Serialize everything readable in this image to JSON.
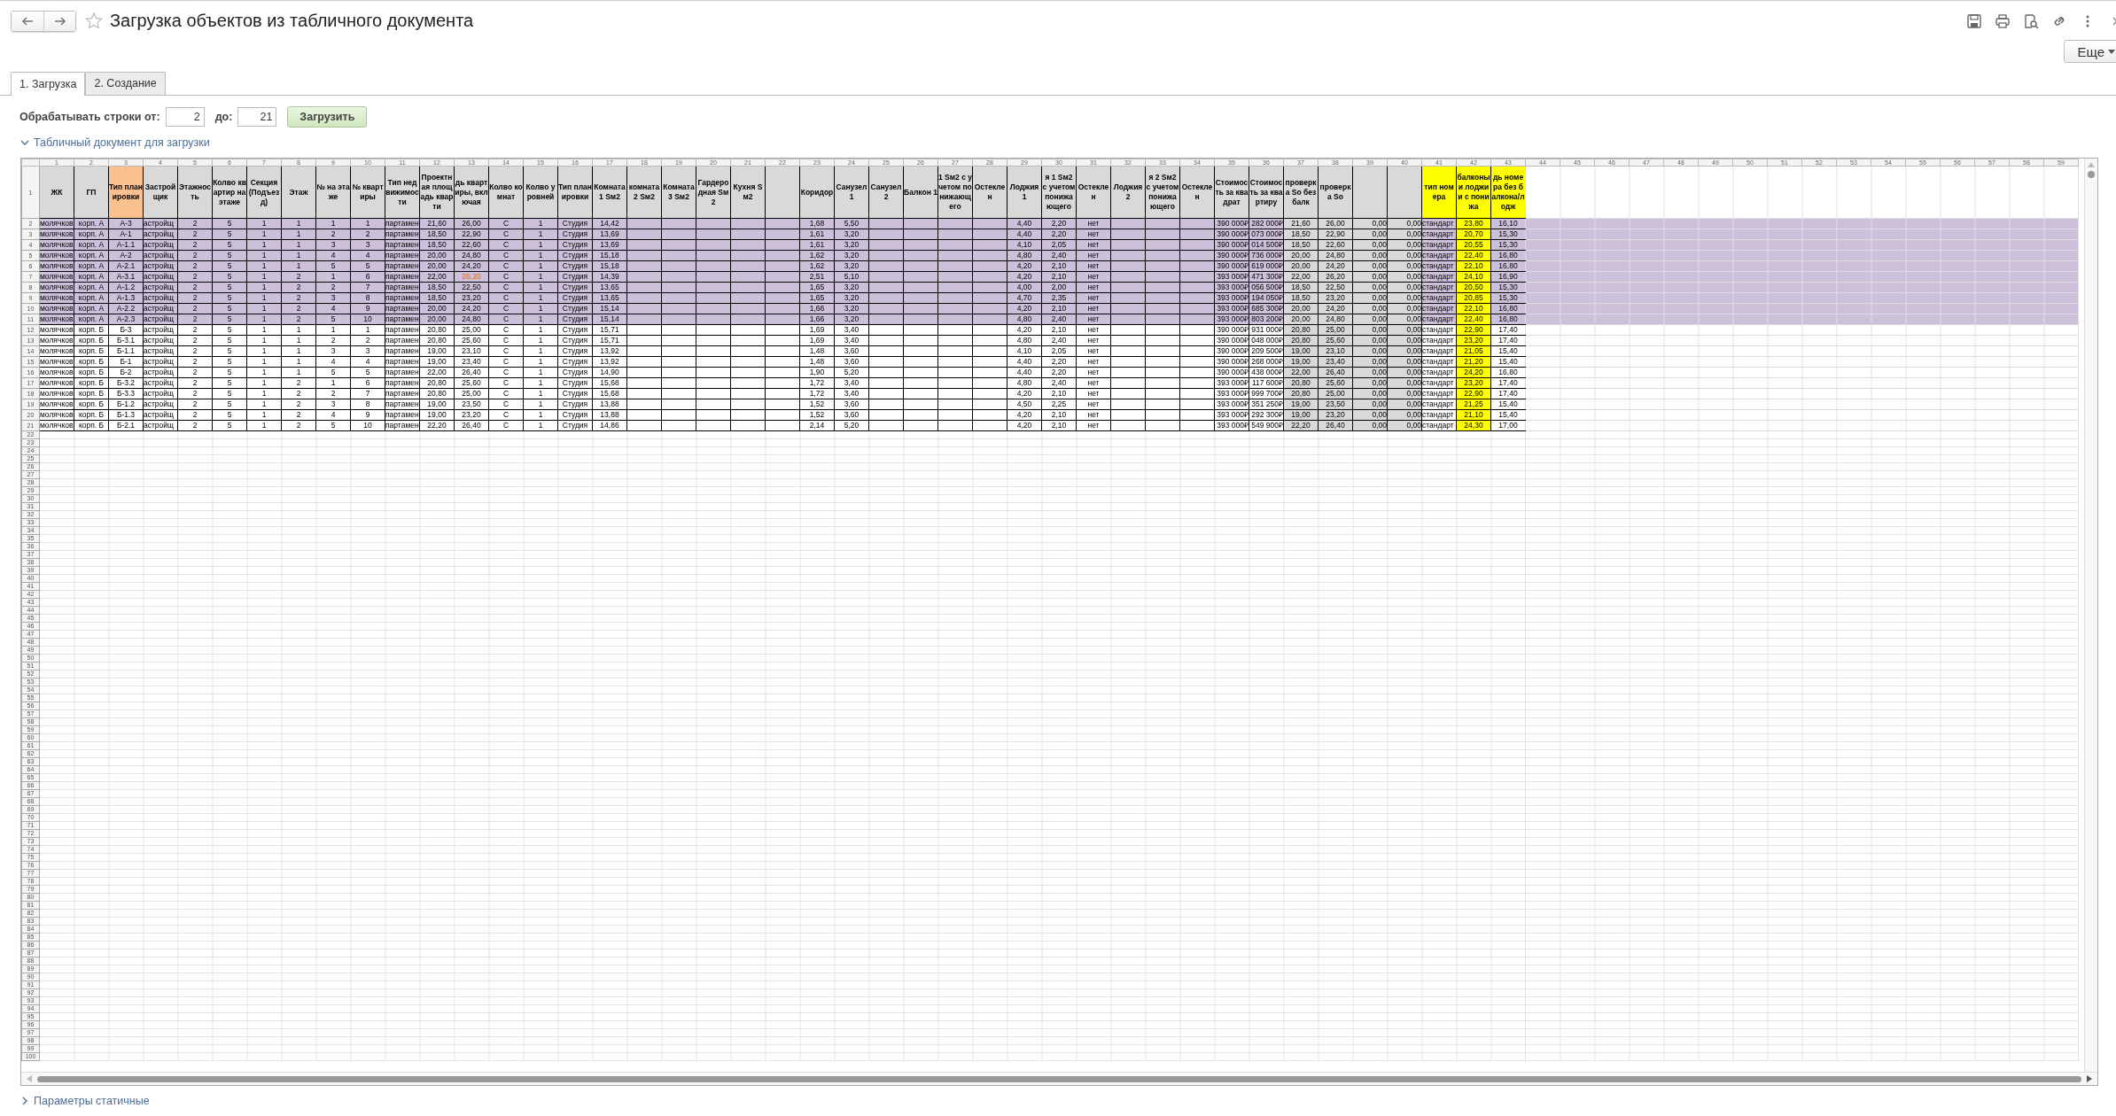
{
  "window": {
    "title": "Загрузка объектов из табличного документа",
    "favorite": false
  },
  "toolbar": {
    "more_button": "Еще"
  },
  "tabs": [
    {
      "label": "1. Загрузка",
      "selected": true
    },
    {
      "label": "2. Создание",
      "selected": false
    }
  ],
  "range": {
    "label": "Обрабатывать строки от:",
    "from": "2",
    "to_label": "до:",
    "to": "21",
    "button": "Загрузить"
  },
  "sheet_section": {
    "title": "Табличный документ для загрузки",
    "expanded": true
  },
  "sheet": {
    "header_row": "1",
    "columns": [
      {
        "number": "1",
        "title": "ЖК",
        "color": "#d9d9d9"
      },
      {
        "number": "2",
        "title": "ГП",
        "color": "#d9d9d9"
      },
      {
        "number": "3",
        "title": "Тип планировки",
        "color": "#fac090"
      },
      {
        "number": "4",
        "title": "Застройщик",
        "color": "#d9d9d9"
      },
      {
        "number": "5",
        "title": "Этажность",
        "color": "#d9d9d9"
      },
      {
        "number": "6",
        "title": "Колво квартир на этаже",
        "color": "#d9d9d9"
      },
      {
        "number": "7",
        "title": "Секция (Подъезд)",
        "color": "#d9d9d9"
      },
      {
        "number": "8",
        "title": "Этаж",
        "color": "#d9d9d9"
      },
      {
        "number": "9",
        "title": "№ на этаже",
        "color": "#d9d9d9"
      },
      {
        "number": "10",
        "title": "№ квартиры",
        "color": "#d9d9d9"
      },
      {
        "number": "11",
        "title": "Тип недвижимости",
        "color": "#d9d9d9"
      },
      {
        "number": "12",
        "title": "Проектная площадь кварти",
        "color": "#d9d9d9"
      },
      {
        "number": "13",
        "title": "дь квартиры, включая",
        "color": "#d9d9d9"
      },
      {
        "number": "14",
        "title": "Колво комнат",
        "color": "#d9d9d9"
      },
      {
        "number": "15",
        "title": "Колво уровней",
        "color": "#d9d9d9"
      },
      {
        "number": "16",
        "title": "Тип планировки",
        "color": "#d9d9d9"
      },
      {
        "number": "17",
        "title": "Комната1 Sм2",
        "color": "#d9d9d9"
      },
      {
        "number": "18",
        "title": "комната2 Sм2",
        "color": "#d9d9d9"
      },
      {
        "number": "19",
        "title": "Комната3 Sм2",
        "color": "#d9d9d9"
      },
      {
        "number": "20",
        "title": "Гардеродная Sм2",
        "color": "#d9d9d9"
      },
      {
        "number": "21",
        "title": "Кухня Sм2",
        "color": "#d9d9d9"
      },
      {
        "number": "22",
        "color": "#d9d9d9"
      },
      {
        "number": "23",
        "title": "Коридор",
        "color": "#d9d9d9"
      },
      {
        "number": "24",
        "title": "Санузел 1",
        "color": "#d9d9d9"
      },
      {
        "number": "25",
        "title": "Санузел 2",
        "color": "#d9d9d9"
      },
      {
        "number": "26",
        "title": "Балкон 1",
        "color": "#d9d9d9"
      },
      {
        "number": "27",
        "title": "1 Sм2 с учетом понижающего",
        "color": "#d9d9d9"
      },
      {
        "number": "28",
        "title": "Остеклен",
        "color": "#d9d9d9"
      },
      {
        "number": "29",
        "title": "Лоджия 1",
        "color": "#d9d9d9"
      },
      {
        "number": "30",
        "title": "я 1 Sм2 с учетом понижающего",
        "color": "#d9d9d9"
      },
      {
        "number": "31",
        "title": "Остеклен",
        "color": "#d9d9d9"
      },
      {
        "number": "32",
        "title": "Лоджия 2",
        "color": "#d9d9d9"
      },
      {
        "number": "33",
        "title": "я 2 Sм2 с учетом понижающего",
        "color": "#d9d9d9"
      },
      {
        "number": "34",
        "title": "Остеклен",
        "color": "#d9d9d9"
      },
      {
        "number": "35",
        "title": "Стоимость за квадрат",
        "color": "#d9d9d9"
      },
      {
        "number": "36",
        "title": "Стоимость за квартиру",
        "color": "#d9d9d9"
      },
      {
        "number": "37",
        "title": "проверка So без балк",
        "color": "#d9d9d9",
        "kind": "shaded"
      },
      {
        "number": "38",
        "title": "проверка So",
        "color": "#d9d9d9",
        "kind": "shaded"
      },
      {
        "number": "39",
        "color": "#d9d9d9",
        "kind": "shaded"
      },
      {
        "number": "40",
        "color": "#d9d9d9",
        "kind": "shaded"
      },
      {
        "number": "41",
        "title": "тип номера",
        "color": "#ffff00"
      },
      {
        "number": "42",
        "title": "балконы и лоджии с понижа",
        "color": "#ffff00",
        "kind": "marked"
      },
      {
        "number": "43",
        "title": "дь номера без балкона/лодж",
        "color": "#ffff00"
      }
    ],
    "extra_columns": [
      "44",
      "45",
      "46",
      "47",
      "48",
      "49",
      "50",
      "51",
      "52",
      "53",
      "54",
      "55",
      "56",
      "57",
      "58",
      "59"
    ],
    "rows": [
      {
        "number": "2",
        "highlighted": true,
        "cells": [
          "молячков",
          "корп. А",
          "А-3",
          "астройщ",
          "2",
          "5",
          "1",
          "1",
          "1",
          "1",
          "партамен",
          "21,60",
          "26,00",
          "С",
          "1",
          "Студия",
          "14,42",
          null,
          null,
          null,
          null,
          null,
          "1,68",
          "5,50",
          null,
          null,
          null,
          null,
          "4,40",
          "2,20",
          "нет",
          null,
          null,
          null,
          "390 000₽",
          "282 000₽",
          "21,60",
          "26,00",
          "0,00",
          "0,00",
          "стандарт",
          "23,80",
          "16,10"
        ]
      },
      {
        "number": "3",
        "highlighted": true,
        "cells": [
          "молячков",
          "корп. А",
          "А-1",
          "астройщ",
          "2",
          "5",
          "1",
          "1",
          "2",
          "2",
          "партамен",
          "18,50",
          "22,90",
          "С",
          "1",
          "Студия",
          "13,69",
          null,
          null,
          null,
          null,
          null,
          "1,61",
          "3,20",
          null,
          null,
          null,
          null,
          "4,40",
          "2,20",
          "нет",
          null,
          null,
          null,
          "390 000₽",
          "073 000₽",
          "18,50",
          "22,90",
          "0,00",
          "0,00",
          "стандарт",
          "20,70",
          "15,30"
        ]
      },
      {
        "number": "4",
        "highlighted": true,
        "cells": [
          "молячков",
          "корп. А",
          "А-1.1",
          "астройщ",
          "2",
          "5",
          "1",
          "1",
          "3",
          "3",
          "партамен",
          "18,50",
          "22,60",
          "С",
          "1",
          "Студия",
          "13,69",
          null,
          null,
          null,
          null,
          null,
          "1,61",
          "3,20",
          null,
          null,
          null,
          null,
          "4,10",
          "2,05",
          "нет",
          null,
          null,
          null,
          "390 000₽",
          "014 500₽",
          "18,50",
          "22,60",
          "0,00",
          "0,00",
          "стандарт",
          "20,55",
          "15,30"
        ]
      },
      {
        "number": "5",
        "highlighted": true,
        "cells": [
          "молячков",
          "корп. А",
          "А-2",
          "астройщ",
          "2",
          "5",
          "1",
          "1",
          "4",
          "4",
          "партамен",
          "20,00",
          "24,80",
          "С",
          "1",
          "Студия",
          "15,18",
          null,
          null,
          null,
          null,
          null,
          "1,62",
          "3,20",
          null,
          null,
          null,
          null,
          "4,80",
          "2,40",
          "нет",
          null,
          null,
          null,
          "390 000₽",
          "736 000₽",
          "20,00",
          "24,80",
          "0,00",
          "0,00",
          "стандарт",
          "22,40",
          "16,80"
        ]
      },
      {
        "number": "6",
        "highlighted": true,
        "cells": [
          "молячков",
          "корп. А",
          "А-2.1",
          "астройщ",
          "2",
          "5",
          "1",
          "1",
          "5",
          "5",
          "партамен",
          "20,00",
          "24,20",
          "С",
          "1",
          "Студия",
          "15,18",
          null,
          null,
          null,
          null,
          null,
          "1,62",
          "3,20",
          null,
          null,
          null,
          null,
          "4,20",
          "2,10",
          "нет",
          null,
          null,
          null,
          "390 000₽",
          "619 000₽",
          "20,00",
          "24,20",
          "0,00",
          "0,00",
          "стандарт",
          "22,10",
          "16,80"
        ]
      },
      {
        "number": "7",
        "highlighted": true,
        "cells": [
          "молячков",
          "корп. А",
          "А-3.1",
          "астройщ",
          "2",
          "5",
          "1",
          "2",
          "1",
          "6",
          "партамен",
          "22,00",
          {
            "text": "26,20",
            "alert": true
          },
          "С",
          "1",
          "Студия",
          "14,39",
          null,
          null,
          null,
          null,
          null,
          "2,51",
          "5,10",
          null,
          null,
          null,
          null,
          "4,20",
          "2,10",
          "нет",
          null,
          null,
          null,
          "393 000₽",
          "471 300₽",
          "22,00",
          "26,20",
          "0,00",
          "0,00",
          "стандарт",
          "24,10",
          "16,90"
        ]
      },
      {
        "number": "8",
        "highlighted": true,
        "cells": [
          "молячков",
          "корп. А",
          "А-1.2",
          "астройщ",
          "2",
          "5",
          "1",
          "2",
          "2",
          "7",
          "партамен",
          "18,50",
          "22,50",
          "С",
          "1",
          "Студия",
          "13,65",
          null,
          null,
          null,
          null,
          null,
          "1,65",
          "3,20",
          null,
          null,
          null,
          null,
          "4,00",
          "2,00",
          "нет",
          null,
          null,
          null,
          "393 000₽",
          "056 500₽",
          "18,50",
          "22,50",
          "0,00",
          "0,00",
          "стандарт",
          "20,50",
          "15,30"
        ]
      },
      {
        "number": "9",
        "highlighted": true,
        "cells": [
          "молячков",
          "корп. А",
          "А-1.3",
          "астройщ",
          "2",
          "5",
          "1",
          "2",
          "3",
          "8",
          "партамен",
          "18,50",
          "23,20",
          "С",
          "1",
          "Студия",
          "13,65",
          null,
          null,
          null,
          null,
          null,
          "1,65",
          "3,20",
          null,
          null,
          null,
          null,
          "4,70",
          "2,35",
          "нет",
          null,
          null,
          null,
          "393 000₽",
          "194 050₽",
          "18,50",
          "23,20",
          "0,00",
          "0,00",
          "стандарт",
          "20,85",
          "15,30"
        ]
      },
      {
        "number": "10",
        "highlighted": true,
        "cells": [
          "молячков",
          "корп. А",
          "А-2.2",
          "астройщ",
          "2",
          "5",
          "1",
          "2",
          "4",
          "9",
          "партамен",
          "20,00",
          "24,20",
          "С",
          "1",
          "Студия",
          "15,14",
          null,
          null,
          null,
          null,
          null,
          "1,66",
          "3,20",
          null,
          null,
          null,
          null,
          "4,20",
          "2,10",
          "нет",
          null,
          null,
          null,
          "393 000₽",
          "685 300₽",
          "20,00",
          "24,20",
          "0,00",
          "0,00",
          "стандарт",
          "22,10",
          "16,80"
        ]
      },
      {
        "number": "11",
        "highlighted": true,
        "cells": [
          "молячков",
          "корп. А",
          "А-2.3",
          "астройщ",
          "2",
          "5",
          "1",
          "2",
          "5",
          "10",
          "партамен",
          "20,00",
          "24,80",
          "С",
          "1",
          "Студия",
          "15,14",
          null,
          null,
          null,
          null,
          null,
          "1,66",
          "3,20",
          null,
          null,
          null,
          null,
          "4,80",
          "2,40",
          "нет",
          null,
          null,
          null,
          "393 000₽",
          "803 200₽",
          "20,00",
          "24,80",
          "0,00",
          "0,00",
          "стандарт",
          "22,40",
          "16,80"
        ]
      },
      {
        "number": "12",
        "highlighted": false,
        "cells": [
          "молячков",
          "корп. Б",
          "Б-3",
          "астройщ",
          "2",
          "5",
          "1",
          "1",
          "1",
          "1",
          "партамен",
          "20,80",
          "25,00",
          "С",
          "1",
          "Студия",
          "15,71",
          null,
          null,
          null,
          null,
          null,
          "1,69",
          "3,40",
          null,
          null,
          null,
          null,
          "4,20",
          "2,10",
          "нет",
          null,
          null,
          null,
          "390 000₽",
          "931 000₽",
          "20,80",
          "25,00",
          "0,00",
          "0,00",
          "стандарт",
          "22,90",
          "17,40"
        ]
      },
      {
        "number": "13",
        "highlighted": false,
        "cells": [
          "молячков",
          "корп. Б",
          "Б-3.1",
          "астройщ",
          "2",
          "5",
          "1",
          "1",
          "2",
          "2",
          "партамен",
          "20,80",
          "25,60",
          "С",
          "1",
          "Студия",
          "15,71",
          null,
          null,
          null,
          null,
          null,
          "1,69",
          "3,40",
          null,
          null,
          null,
          null,
          "4,80",
          "2,40",
          "нет",
          null,
          null,
          null,
          "390 000₽",
          "048 000₽",
          "20,80",
          "25,60",
          "0,00",
          "0,00",
          "стандарт",
          "23,20",
          "17,40"
        ]
      },
      {
        "number": "14",
        "highlighted": false,
        "cells": [
          "молячков",
          "корп. Б",
          "Б-1.1",
          "астройщ",
          "2",
          "5",
          "1",
          "1",
          "3",
          "3",
          "партамен",
          "19,00",
          "23,10",
          "С",
          "1",
          "Студия",
          "13,92",
          null,
          null,
          null,
          null,
          null,
          "1,48",
          "3,60",
          null,
          null,
          null,
          null,
          "4,10",
          "2,05",
          "нет",
          null,
          null,
          null,
          "390 000₽",
          "209 500₽",
          "19,00",
          "23,10",
          "0,00",
          "0,00",
          "стандарт",
          "21,05",
          "15,40"
        ]
      },
      {
        "number": "15",
        "highlighted": false,
        "cells": [
          "молячков",
          "корп. Б",
          "Б-1",
          "астройщ",
          "2",
          "5",
          "1",
          "1",
          "4",
          "4",
          "партамен",
          "19,00",
          "23,40",
          "С",
          "1",
          "Студия",
          "13,92",
          null,
          null,
          null,
          null,
          null,
          "1,48",
          "3,60",
          null,
          null,
          null,
          null,
          "4,40",
          "2,20",
          "нет",
          null,
          null,
          null,
          "390 000₽",
          "268 000₽",
          "19,00",
          "23,40",
          "0,00",
          "0,00",
          "стандарт",
          "21,20",
          "15,40"
        ]
      },
      {
        "number": "16",
        "highlighted": false,
        "cells": [
          "молячков",
          "корп. Б",
          "Б-2",
          "астройщ",
          "2",
          "5",
          "1",
          "1",
          "5",
          "5",
          "партамен",
          "22,00",
          "26,40",
          "С",
          "1",
          "Студия",
          "14,90",
          null,
          null,
          null,
          null,
          null,
          "1,90",
          "5,20",
          null,
          null,
          null,
          null,
          "4,40",
          "2,20",
          "нет",
          null,
          null,
          null,
          "390 000₽",
          "438 000₽",
          "22,00",
          "26,40",
          "0,00",
          "0,00",
          "стандарт",
          "24,20",
          "16,80"
        ]
      },
      {
        "number": "17",
        "highlighted": false,
        "cells": [
          "молячков",
          "корп. Б",
          "Б-3.2",
          "астройщ",
          "2",
          "5",
          "1",
          "2",
          "1",
          "6",
          "партамен",
          "20,80",
          "25,60",
          "С",
          "1",
          "Студия",
          "15,68",
          null,
          null,
          null,
          null,
          null,
          "1,72",
          "3,40",
          null,
          null,
          null,
          null,
          "4,80",
          "2,40",
          "нет",
          null,
          null,
          null,
          "393 000₽",
          "117 600₽",
          "20,80",
          "25,60",
          "0,00",
          "0,00",
          "стандарт",
          "23,20",
          "17,40"
        ]
      },
      {
        "number": "18",
        "highlighted": false,
        "cells": [
          "молячков",
          "корп. Б",
          "Б-3.3",
          "астройщ",
          "2",
          "5",
          "1",
          "2",
          "2",
          "7",
          "партамен",
          "20,80",
          "25,00",
          "С",
          "1",
          "Студия",
          "15,68",
          null,
          null,
          null,
          null,
          null,
          "1,72",
          "3,40",
          null,
          null,
          null,
          null,
          "4,20",
          "2,10",
          "нет",
          null,
          null,
          null,
          "393 000₽",
          "999 700₽",
          "20,80",
          "25,00",
          "0,00",
          "0,00",
          "стандарт",
          "22,90",
          "17,40"
        ]
      },
      {
        "number": "19",
        "highlighted": false,
        "cells": [
          "молячков",
          "корп. Б",
          "Б-1.2",
          "астройщ",
          "2",
          "5",
          "1",
          "2",
          "3",
          "8",
          "партамен",
          "19,00",
          "23,50",
          "С",
          "1",
          "Студия",
          "13,88",
          null,
          null,
          null,
          null,
          null,
          "1,52",
          "3,60",
          null,
          null,
          null,
          null,
          "4,50",
          "2,25",
          "нет",
          null,
          null,
          null,
          "393 000₽",
          "351 250₽",
          "19,00",
          "23,50",
          "0,00",
          "0,00",
          "стандарт",
          "21,25",
          "15,40"
        ]
      },
      {
        "number": "20",
        "highlighted": false,
        "cells": [
          "молячков",
          "корп. Б",
          "Б-1.3",
          "астройщ",
          "2",
          "5",
          "1",
          "2",
          "4",
          "9",
          "партамен",
          "19,00",
          "23,20",
          "С",
          "1",
          "Студия",
          "13,88",
          null,
          null,
          null,
          null,
          null,
          "1,52",
          "3,60",
          null,
          null,
          null,
          null,
          "4,20",
          "2,10",
          "нет",
          null,
          null,
          null,
          "393 000₽",
          "292 300₽",
          "19,00",
          "23,20",
          "0,00",
          "0,00",
          "стандарт",
          "21,10",
          "15,40"
        ]
      },
      {
        "number": "21",
        "highlighted": false,
        "cells": [
          "молячков",
          "корп. Б",
          "Б-2.1",
          "астройщ",
          "2",
          "5",
          "1",
          "2",
          "5",
          "10",
          "партамен",
          "22,20",
          "26,40",
          "С",
          "1",
          "Студия",
          "14,86",
          null,
          null,
          null,
          null,
          null,
          "2,14",
          "5,20",
          null,
          null,
          null,
          null,
          "4,20",
          "2,10",
          "нет",
          null,
          null,
          null,
          "393 000₽",
          "549 900₽",
          "22,20",
          "26,40",
          "0,00",
          "0,00",
          "стандарт",
          "24,30",
          "17,00"
        ]
      }
    ],
    "empty_rows": [
      "22",
      "23",
      "24",
      "25",
      "26",
      "27",
      "28",
      "29",
      "30",
      "31",
      "32",
      "33",
      "34",
      "35",
      "36",
      "37",
      "38",
      "39",
      "40",
      "41",
      "42",
      "43",
      "44",
      "45",
      "46",
      "47",
      "48",
      "49",
      "50",
      "51",
      "52",
      "53",
      "54",
      "55",
      "56",
      "57",
      "58",
      "59",
      "60",
      "61",
      "62",
      "63",
      "64",
      "65",
      "66",
      "67",
      "68",
      "69",
      "70",
      "71",
      "72",
      "73",
      "74",
      "75",
      "76",
      "77",
      "78",
      "79",
      "80",
      "81",
      "82",
      "83",
      "84",
      "85",
      "86",
      "87",
      "88",
      "89",
      "90",
      "91",
      "92",
      "93",
      "94",
      "95",
      "96",
      "97",
      "98",
      "99",
      "100"
    ]
  },
  "params_section": {
    "title": "Параметры статичные",
    "expanded": false
  }
}
